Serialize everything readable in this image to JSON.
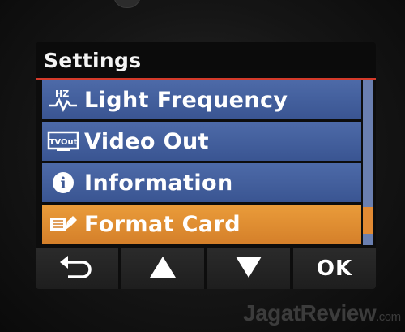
{
  "screen": {
    "title": "Settings"
  },
  "menu": {
    "items": [
      {
        "label": "Light Frequency",
        "icon": "hz-wave-icon",
        "icon_text": "HZ",
        "selected": false
      },
      {
        "label": "Video Out",
        "icon": "tv-out-icon",
        "icon_text": "TVOut",
        "selected": false
      },
      {
        "label": "Information",
        "icon": "info-icon",
        "icon_text": "i",
        "selected": false
      },
      {
        "label": "Format Card",
        "icon": "format-card-icon",
        "selected": true
      }
    ]
  },
  "scrollbar": {
    "thumb_start": 0.77,
    "thumb_end": 0.93
  },
  "softkeys": {
    "back_icon": "back-arrow-icon",
    "up_icon": "up-triangle-icon",
    "down_icon": "down-triangle-icon",
    "ok_label": "OK"
  },
  "watermark": {
    "brand": "JagatReview",
    "suffix": ".com"
  },
  "colors": {
    "menu_item": "#4461a0",
    "selected_item": "#e08f34",
    "title_underline": "#d43a2a",
    "softkey_bg": "#252525"
  }
}
